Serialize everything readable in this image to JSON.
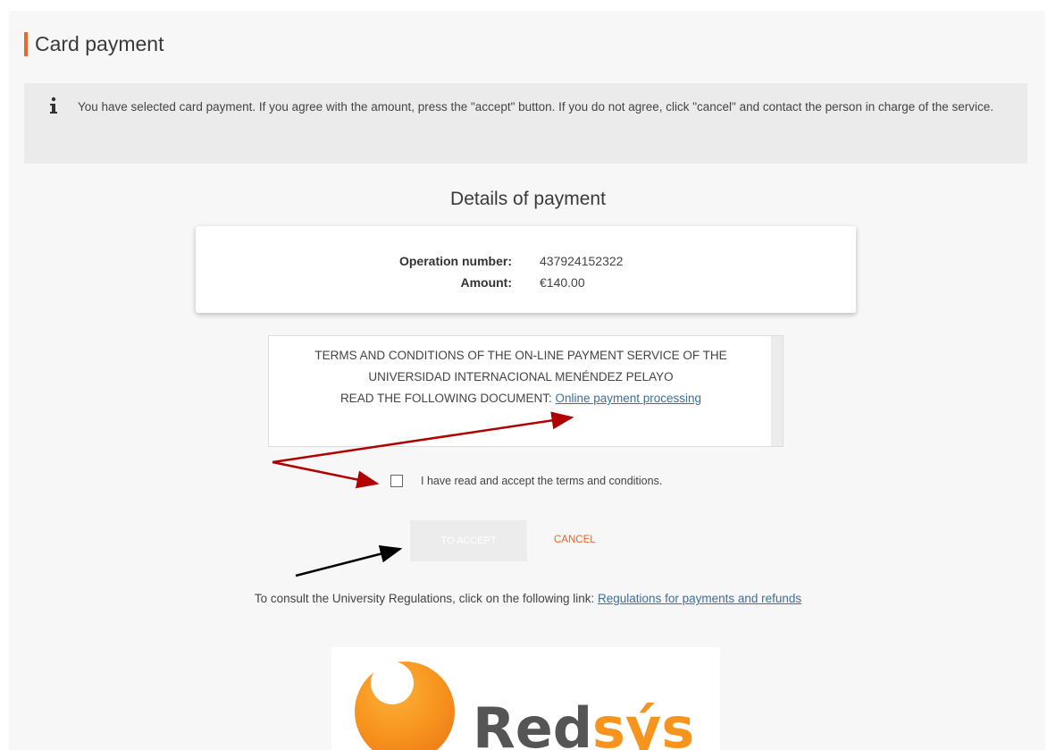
{
  "page": {
    "title": "Card payment",
    "accent_color": "#f26522"
  },
  "info": {
    "icon": "info-icon",
    "text": "You have selected card payment. If you agree with the amount, press the \"accept\" button. If you do not agree, click \"cancel\" and contact the person in charge of the service."
  },
  "details": {
    "heading": "Details of payment",
    "operation_label": "Operation number:",
    "operation_value": "437924152322",
    "amount_label": "Amount:",
    "amount_value": "€140.00"
  },
  "terms": {
    "line1": "TERMS AND CONDITIONS OF THE ON-LINE PAYMENT SERVICE OF THE",
    "line2": "UNIVERSIDAD INTERNACIONAL MENÉNDEZ PELAYO",
    "line3_prefix": "READ THE FOLLOWING DOCUMENT: ",
    "link_text": "Online payment processing"
  },
  "acceptance": {
    "checkbox_checked": false,
    "label": "I have read and accept the terms and conditions."
  },
  "actions": {
    "accept_label": "TO ACCEPT",
    "cancel_label": "CANCEL"
  },
  "regulations": {
    "prefix": "To consult the University Regulations, click on the following link: ",
    "link_text": "Regulations for payments and refunds"
  },
  "logo": {
    "text_main": "Red",
    "text_accent": "sýs"
  },
  "annotations": {
    "arrow_colors": [
      "#b00000",
      "#000000"
    ]
  }
}
